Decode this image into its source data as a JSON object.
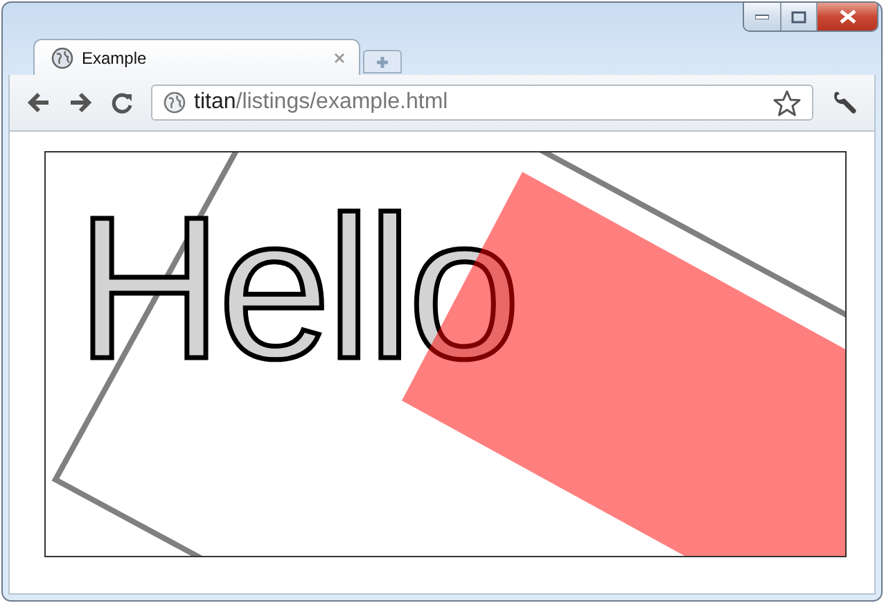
{
  "tabs": [
    {
      "title": "Example",
      "selected": true
    }
  ],
  "address": {
    "host": "titan",
    "path": "/listings/example.html"
  },
  "canvas": {
    "text": "Hello"
  }
}
